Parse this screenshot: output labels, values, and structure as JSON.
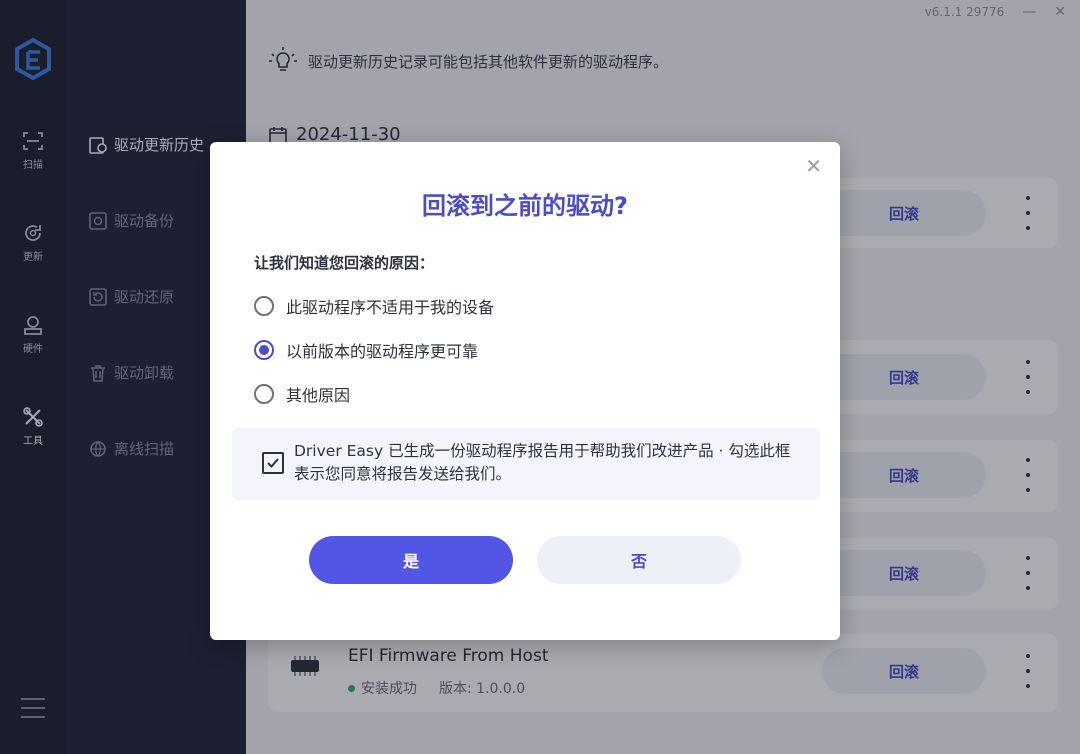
{
  "window": {
    "version": "v6.1.1 29776",
    "minimize": "—",
    "close": "✕"
  },
  "rail": {
    "items": [
      {
        "label": "扫描",
        "icon": "scan-icon"
      },
      {
        "label": "更新",
        "icon": "update-icon"
      },
      {
        "label": "硬件",
        "icon": "hardware-icon"
      },
      {
        "label": "工具",
        "icon": "tools-icon"
      }
    ]
  },
  "sidebar": {
    "items": [
      {
        "label": "驱动更新历史",
        "icon": "history-icon",
        "active": true
      },
      {
        "label": "驱动备份",
        "icon": "backup-icon"
      },
      {
        "label": "驱动还原",
        "icon": "restore-icon"
      },
      {
        "label": "驱动卸载",
        "icon": "trash-icon"
      },
      {
        "label": "离线扫描",
        "icon": "offline-scan-icon"
      }
    ]
  },
  "main": {
    "tip": "驱动更新历史记录可能包括其他软件更新的驱动程序。",
    "date": "2024-11-30",
    "rollback_label": "回滚",
    "device": {
      "name": "EFI Firmware From Host",
      "status": "安装成功",
      "version": "版本: 1.0.0.0"
    }
  },
  "dialog": {
    "title": "回滚到之前的驱动?",
    "reason_label": "让我们知道您回滚的原因：",
    "options": [
      {
        "label": "此驱动程序不适用于我的设备",
        "checked": false
      },
      {
        "label": "以前版本的驱动程序更可靠",
        "checked": true
      },
      {
        "label": "其他原因",
        "checked": false
      }
    ],
    "consent_text": "Driver Easy 已生成一份驱动程序报告用于帮助我们改进产品 · 勾选此框表示您同意将报告发送给我们。",
    "consent_checked": true,
    "yes_label": "是",
    "no_label": "否",
    "close_icon": "close-icon"
  },
  "colors": {
    "accent": "#5356e5",
    "accent_text": "#4a4cc8",
    "rail_bg": "#1f2130",
    "sidebar_bg": "#23263a",
    "success": "#2fb36a"
  }
}
